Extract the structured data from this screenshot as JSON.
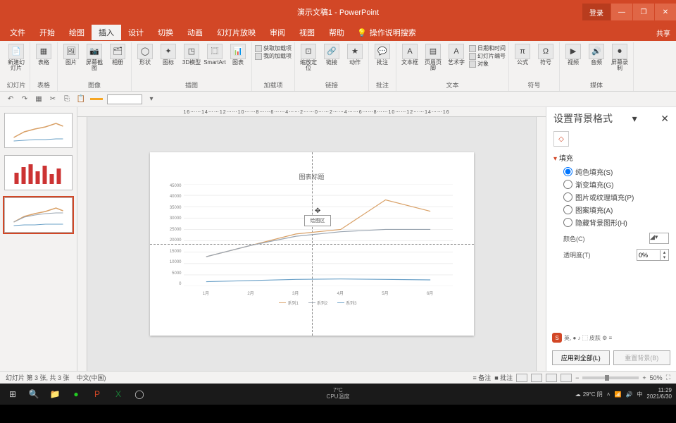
{
  "title_bar": {
    "title": "演示文稿1 - PowerPoint",
    "login": "登录",
    "min": "—",
    "restore": "❐",
    "close": "✕"
  },
  "menu": {
    "items": [
      "文件",
      "开始",
      "绘图",
      "插入",
      "设计",
      "切换",
      "动画",
      "幻灯片放映",
      "审阅",
      "视图",
      "帮助"
    ],
    "active_index": 3,
    "tell_me": "操作说明搜索",
    "share": "共享"
  },
  "ribbon": {
    "groups": [
      {
        "label": "幻灯片",
        "items": [
          {
            "n": "新建幻灯片",
            "i": "📄"
          }
        ]
      },
      {
        "label": "表格",
        "items": [
          {
            "n": "表格",
            "i": "▦"
          }
        ]
      },
      {
        "label": "图像",
        "items": [
          {
            "n": "图片",
            "i": "🖼"
          },
          {
            "n": "屏幕截图",
            "i": "📷"
          },
          {
            "n": "相册",
            "i": "🗂"
          }
        ]
      },
      {
        "label": "插图",
        "items": [
          {
            "n": "形状",
            "i": "◯"
          },
          {
            "n": "图标",
            "i": "✦"
          },
          {
            "n": "3D模型",
            "i": "◳"
          },
          {
            "n": "SmartArt",
            "i": "⿴"
          },
          {
            "n": "图表",
            "i": "📊"
          }
        ]
      },
      {
        "label": "加载项",
        "small": [
          "获取加载项",
          "我的加载项"
        ]
      },
      {
        "label": "链接",
        "items": [
          {
            "n": "缩放定位",
            "i": "⊡"
          },
          {
            "n": "链接",
            "i": "🔗"
          },
          {
            "n": "动作",
            "i": "★"
          }
        ]
      },
      {
        "label": "批注",
        "items": [
          {
            "n": "批注",
            "i": "💬"
          }
        ]
      },
      {
        "label": "文本",
        "items": [
          {
            "n": "文本框",
            "i": "A"
          },
          {
            "n": "页眉页脚",
            "i": "▤"
          },
          {
            "n": "艺术字",
            "i": "A"
          }
        ],
        "small": [
          "日期和时间",
          "幻灯片编号",
          "对象"
        ]
      },
      {
        "label": "符号",
        "items": [
          {
            "n": "公式",
            "i": "π"
          },
          {
            "n": "符号",
            "i": "Ω"
          }
        ]
      },
      {
        "label": "媒体",
        "items": [
          {
            "n": "视频",
            "i": "▶"
          },
          {
            "n": "音频",
            "i": "🔊"
          },
          {
            "n": "屏幕录制",
            "i": "⏺"
          }
        ]
      }
    ]
  },
  "qat": {
    "undo": "↶",
    "redo": "↷"
  },
  "ruler_text": "16⋯⋯14⋯⋯12⋯⋯10⋯⋯8⋯⋯6⋯⋯4⋯⋯2⋯⋯0⋯⋯2⋯⋯4⋯⋯6⋯⋯8⋯⋯10⋯⋯12⋯⋯14⋯⋯16",
  "chart_data": {
    "type": "line",
    "title": "图表标题",
    "categories": [
      "1月",
      "2月",
      "3月",
      "4月",
      "5月",
      "6月"
    ],
    "series": [
      {
        "name": "系列1",
        "color": "#d9a066",
        "values": [
          13000,
          18000,
          23000,
          25000,
          38000,
          33000
        ]
      },
      {
        "name": "系列2",
        "color": "#9aa5b1",
        "values": [
          13000,
          18000,
          22000,
          24000,
          25000,
          25000
        ]
      },
      {
        "name": "系列3",
        "color": "#6aa0c7",
        "values": [
          2000,
          2500,
          3000,
          3200,
          3000,
          2800
        ]
      }
    ],
    "ylim": [
      0,
      45000
    ],
    "yticks": [
      "45000",
      "40000",
      "35000",
      "30000",
      "25000",
      "20000",
      "15000",
      "10000",
      "5000",
      "0"
    ]
  },
  "tooltip": "绘图区",
  "format_pane": {
    "title": "设置背景格式",
    "section": "填充",
    "radios": [
      "纯色填充(S)",
      "渐变填充(G)",
      "图片或纹理填充(P)",
      "图案填充(A)",
      "隐藏背景图形(H)"
    ],
    "checked": 0,
    "color_label": "颜色(C)",
    "transparency_label": "透明度(T)",
    "transparency_value": "0%",
    "btn_apply": "应用到全部(L)",
    "btn_reset": "重置背景(B)"
  },
  "status": {
    "slide": "幻灯片 第 3 张, 共 3 张",
    "lang": "中文(中国)",
    "notes": "≡ 备注",
    "comments": "■ 批注",
    "zoom": "50%"
  },
  "taskbar": {
    "center1": "7°C",
    "center2": "CPU温度",
    "weather": "29°C 阴",
    "time": "11:29",
    "date": "2021/6/30"
  }
}
